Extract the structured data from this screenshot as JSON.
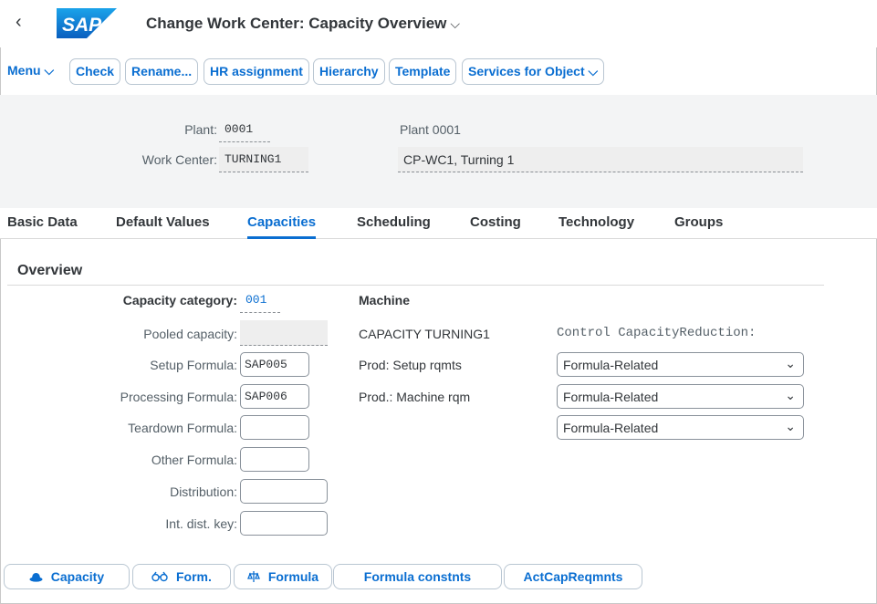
{
  "header": {
    "back_glyph": "‹",
    "logo_text": "SAP",
    "title": "Change Work Center: Capacity Overview",
    "title_chevron": "⌵",
    "brand_color": "#0a6ed1"
  },
  "toolbar": {
    "menu_label": "Menu ⌵",
    "buttons": [
      "Check",
      "Rename...",
      "HR assignment",
      "Hierarchy",
      "Template",
      "Services for Object ⌵"
    ]
  },
  "object_header": {
    "plant_label": "Plant:",
    "plant_value": "0001",
    "plant_desc": "Plant 0001",
    "work_center_label": "Work Center:",
    "work_center_value": "TURNING1",
    "work_center_desc": "CP-WC1, Turning 1"
  },
  "tabs": [
    "Basic Data",
    "Default Values",
    "Capacities",
    "Scheduling",
    "Costing",
    "Technology",
    "Groups"
  ],
  "active_tab": "Capacities",
  "overview": {
    "title": "Overview",
    "capacity_category_label": "Capacity category:",
    "capacity_category_value": "001",
    "capacity_category_text": "Machine",
    "pooled_capacity_label": "Pooled capacity:",
    "pooled_capacity_value": "",
    "capacity_name": "CAPACITY TURNING1",
    "control_label": "Control CapacityReduction:",
    "setup_formula_label": "Setup Formula:",
    "setup_formula_value": "SAP005",
    "setup_formula_text": "Prod: Setup rqmts",
    "processing_formula_label": "Processing Formula:",
    "processing_formula_value": "SAP006",
    "processing_formula_text": "Prod.: Machine rqm",
    "teardown_formula_label": "Teardown Formula:",
    "teardown_formula_value": "",
    "other_formula_label": "Other Formula:",
    "other_formula_value": "",
    "distribution_label": "Distribution:",
    "distribution_value": "",
    "int_dist_key_label": "Int. dist. key:",
    "int_dist_key_value": "",
    "reduction_selects": [
      "Formula-Related",
      "Formula-Related",
      "Formula-Related"
    ],
    "caret_glyph": "⌄"
  },
  "bottom_tabs": [
    {
      "icon": "hat-icon",
      "glyph": "☗",
      "label": "Capacity"
    },
    {
      "icon": "glasses-icon",
      "glyph": "𝟔𝟑",
      "label": "Form."
    },
    {
      "icon": "formula-icon",
      "glyph": "⚖",
      "label": "Formula"
    },
    {
      "icon": "",
      "glyph": "",
      "label": "Formula constnts"
    },
    {
      "icon": "",
      "glyph": "",
      "label": "ActCapReqmnts"
    }
  ]
}
